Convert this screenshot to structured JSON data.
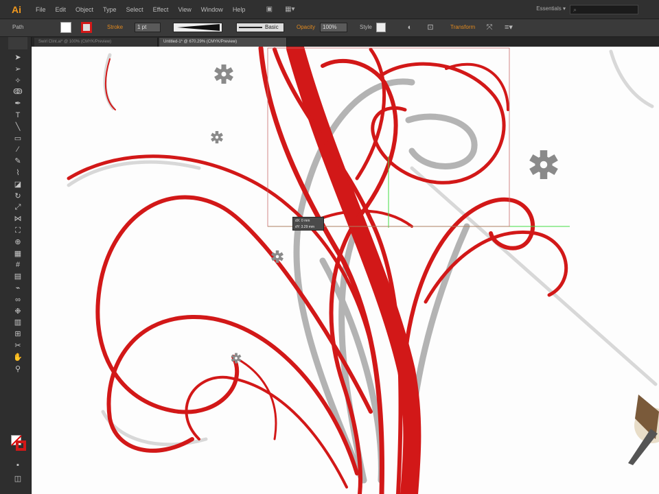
{
  "app": {
    "logo": "Ai"
  },
  "menu": {
    "items": [
      "File",
      "Edit",
      "Object",
      "Type",
      "Select",
      "Effect",
      "View",
      "Window",
      "Help"
    ],
    "workspace": "Essentials",
    "search_icon": "magnifier-icon"
  },
  "control": {
    "selection_label": "Path",
    "stroke_label": "Stroke",
    "stroke_weight": "1 pt",
    "profile_label": "Basic",
    "opacity_label": "Opacity",
    "opacity_value": "100%",
    "style_label": "Style",
    "transform_label": "Transform",
    "accent_color": "#e28a1f"
  },
  "tabs": [
    {
      "label": "Swirl Clint.ai* @ 100% (CMYK/Preview)",
      "active": false
    },
    {
      "label": "Untitled-1* @ 670.29% (CMYK/Preview)",
      "active": true
    }
  ],
  "tooltip": {
    "line1": "dX: 0 mm",
    "line2": "dY: 3.29 mm"
  },
  "colors": {
    "stroke_red": "#d21818",
    "canvas": "#fdfdfd",
    "guide_green": "#44dd44",
    "snowflake": "#8a8a8a"
  }
}
